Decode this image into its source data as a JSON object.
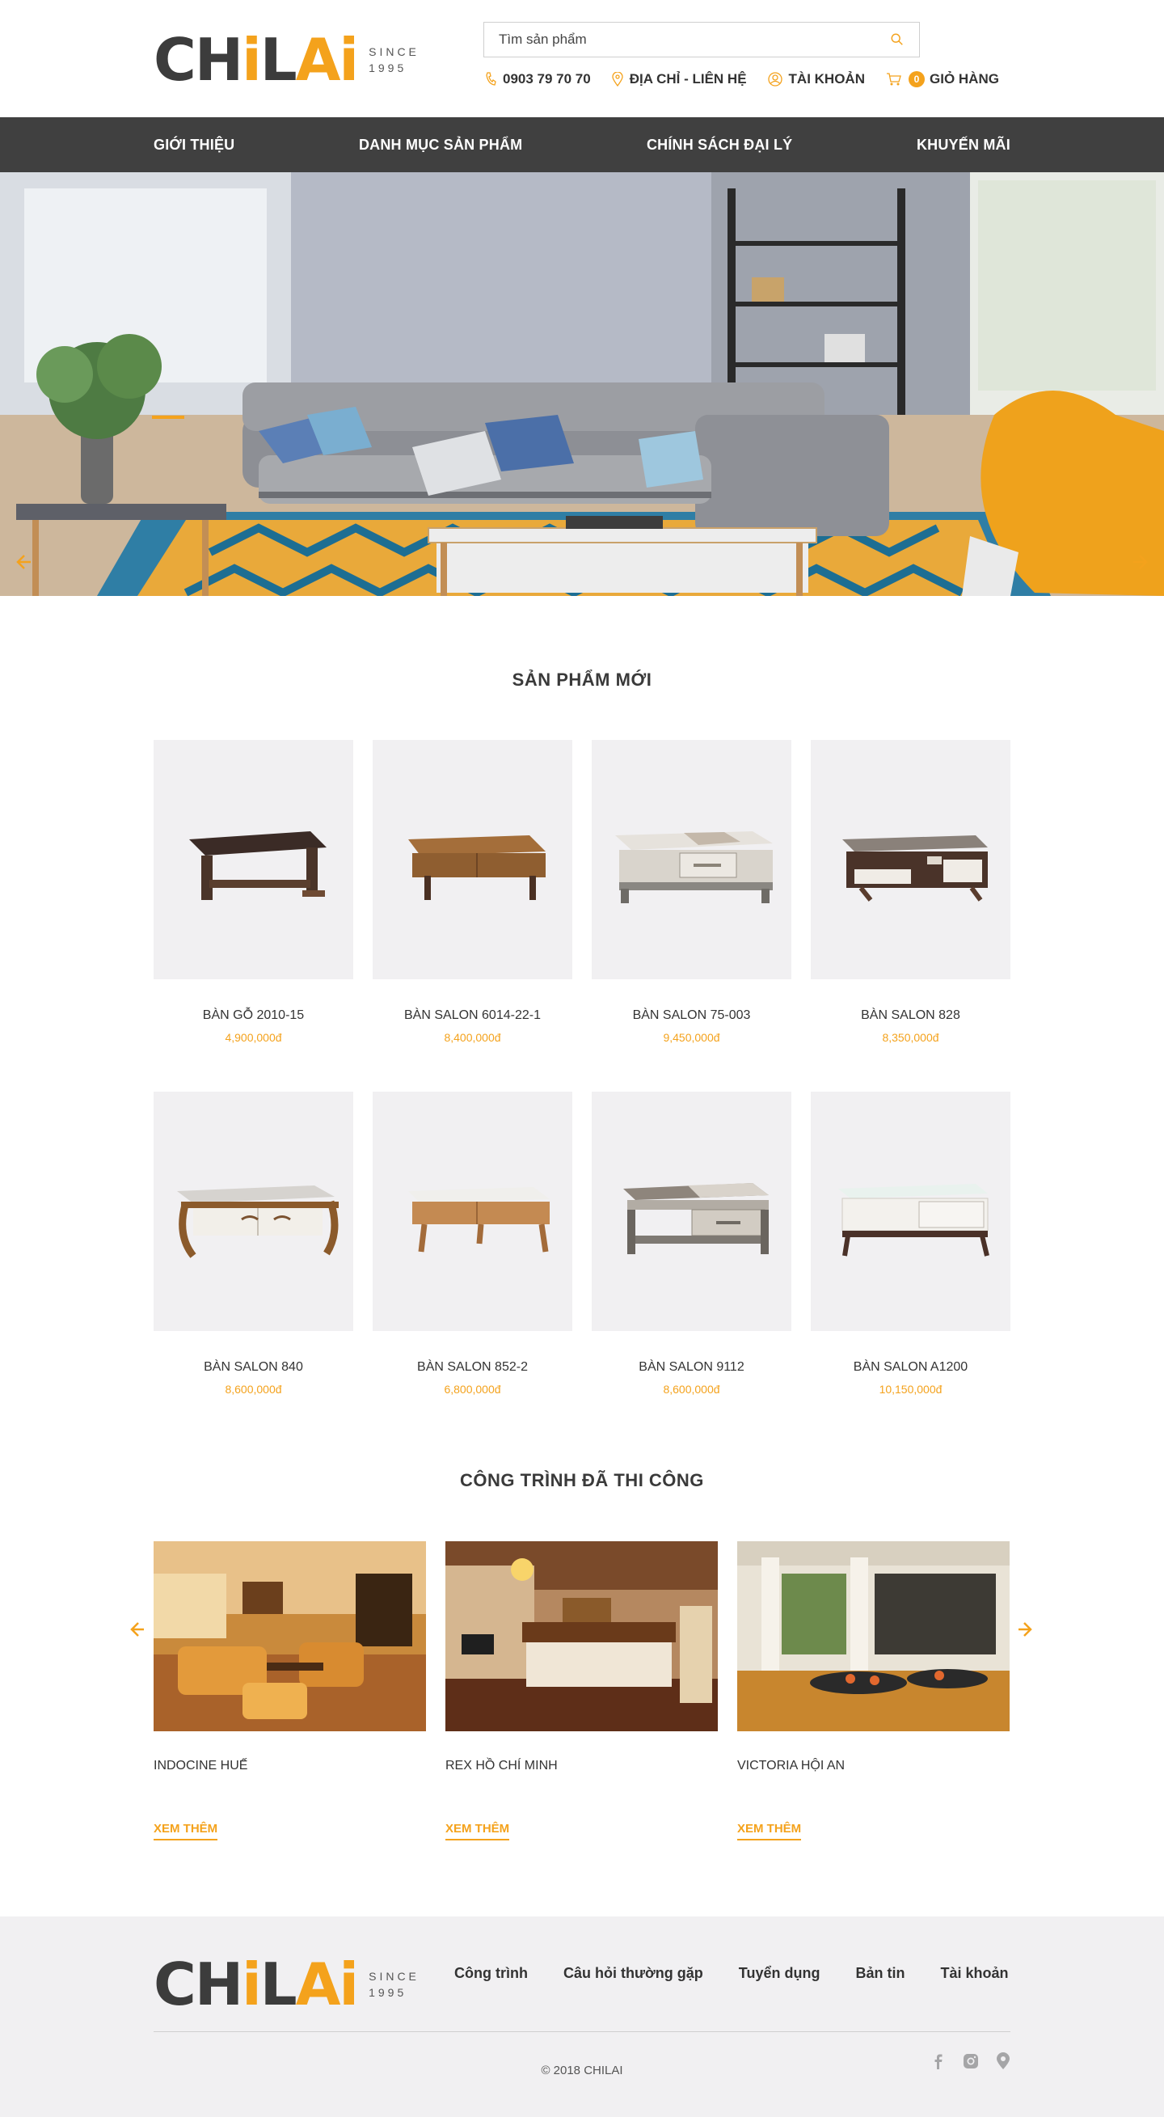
{
  "brand": {
    "word_start": "CH",
    "word_i1": "i",
    "word_mid": "L",
    "word_end": "A",
    "word_i2": "i",
    "since_label": "SINCE",
    "since_year": "1995",
    "accent_color": "#f4a21c",
    "dark_color": "#404040"
  },
  "search": {
    "placeholder": "Tìm sản phẩm"
  },
  "topbar": {
    "phone": "0903 79 70 70",
    "address": "ĐỊA CHỈ - LIÊN HỆ",
    "account": "TÀI KHOẢN",
    "cart_count": "0",
    "cart": "GIỎ HÀNG"
  },
  "nav": [
    "GIỚI THIỆU",
    "DANH MỤC SẢN PHẨM",
    "CHÍNH SÁCH ĐẠI LÝ",
    "KHUYẾN MÃI"
  ],
  "hero": {
    "slides": 3,
    "active_slide": 1
  },
  "new_products": {
    "title": "SẢN PHẨM MỚI",
    "items": [
      {
        "name": "BÀN GỖ 2010-15",
        "price": "4,900,000đ"
      },
      {
        "name": "BÀN SALON 6014-22-1",
        "price": "8,400,000đ"
      },
      {
        "name": "BÀN SALON 75-003",
        "price": "9,450,000đ"
      },
      {
        "name": "BÀN SALON 828",
        "price": "8,350,000đ"
      },
      {
        "name": "BÀN SALON 840",
        "price": "8,600,000đ"
      },
      {
        "name": "BÀN SALON 852-2",
        "price": "6,800,000đ"
      },
      {
        "name": "BÀN SALON 9112",
        "price": "8,600,000đ"
      },
      {
        "name": "BÀN SALON A1200",
        "price": "10,150,000đ"
      }
    ]
  },
  "projects": {
    "title": "CÔNG TRÌNH ĐÃ THI CÔNG",
    "more_label": "XEM THÊM",
    "items": [
      {
        "name": "INDOCINE HUẾ"
      },
      {
        "name": "REX HỒ CHÍ MINH"
      },
      {
        "name": "VICTORIA HỘI AN"
      }
    ]
  },
  "footer": {
    "links": [
      "Công trình",
      "Câu hỏi thường gặp",
      "Tuyển dụng",
      "Bản tin",
      "Tài khoản"
    ],
    "copyright": "© 2018 CHILAI",
    "social_icons": [
      "facebook-icon",
      "instagram-icon",
      "map-pin-icon"
    ]
  }
}
